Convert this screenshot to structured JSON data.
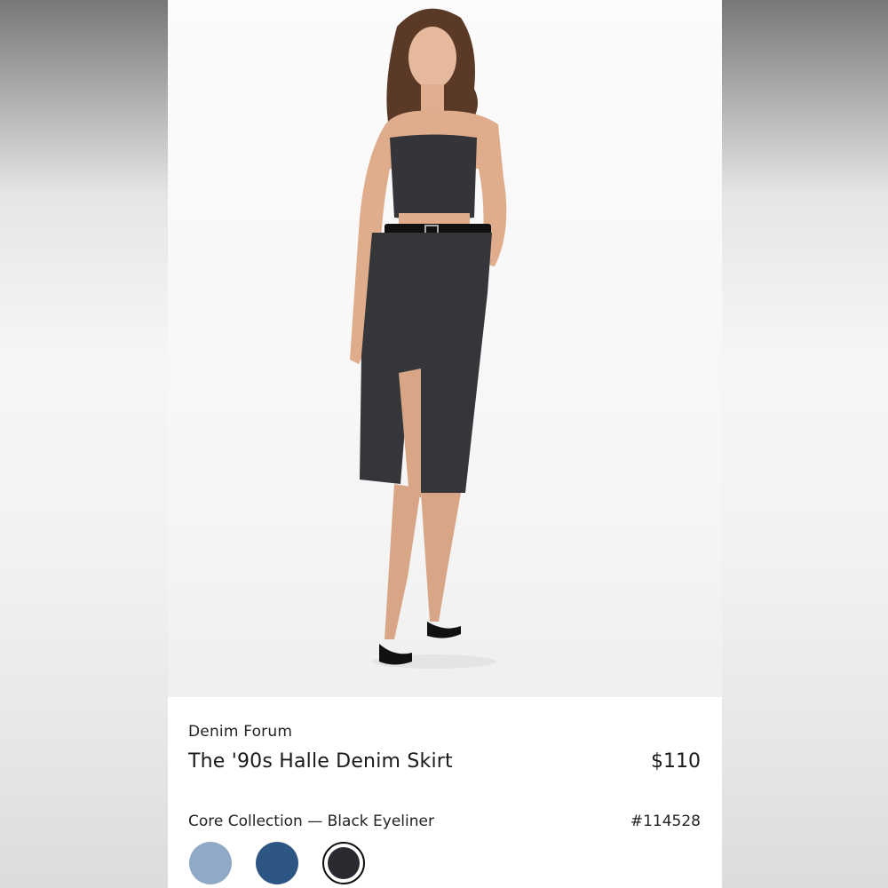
{
  "product": {
    "brand": "Denim Forum",
    "title": "The '90s Halle Denim Skirt",
    "price": "$110",
    "collection": "Core Collection — Black Eyeliner",
    "sku": "#114528"
  },
  "swatches": [
    {
      "name": "light-wash",
      "color": "#8fa9c6"
    },
    {
      "name": "mid-wash",
      "color": "#2d5684"
    },
    {
      "name": "black-eyeliner",
      "color": "#2a2b30",
      "selected": true
    }
  ],
  "colors": {
    "background": "#ffffff",
    "text": "#1a1a1a"
  }
}
